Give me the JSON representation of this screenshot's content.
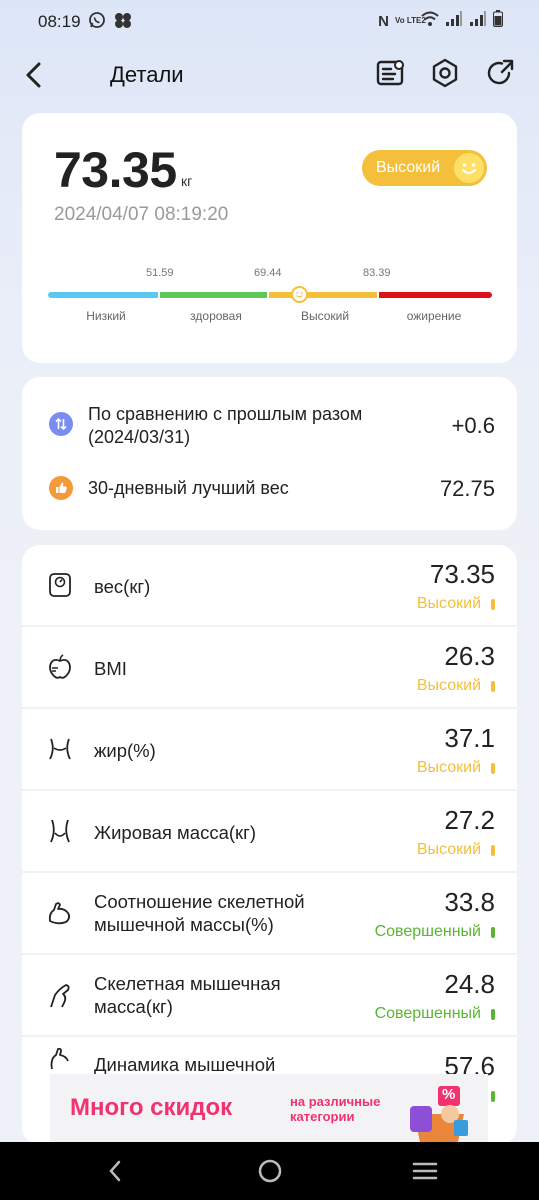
{
  "status_bar": {
    "time": "08:19",
    "left_icons": [
      "whatsapp-icon",
      "app-cluster-icon"
    ],
    "right_icons": [
      "nfc-icon",
      "volte-icon",
      "wifi-icon",
      "signal-icon",
      "signal-icon",
      "battery-icon"
    ],
    "volte_text": "Vo LTE2"
  },
  "header": {
    "title": "Детали",
    "back_icon": "chevron-left-icon",
    "actions": [
      "report-icon",
      "settings-icon",
      "share-icon"
    ]
  },
  "summary": {
    "weight": "73.35",
    "unit": "кг",
    "datetime": "2024/04/07 08:19:20",
    "status": "Высокий",
    "status_color": "#f4bf3a",
    "thresholds": [
      "51.59",
      "69.44",
      "83.39"
    ],
    "ranges": [
      {
        "label": "Низкий",
        "color": "#5ac8f0"
      },
      {
        "label": "здоровая",
        "color": "#5cc85a"
      },
      {
        "label": "Высокий",
        "color": "#f4bf3a"
      },
      {
        "label": "ожирение",
        "color": "#e0101a"
      }
    ]
  },
  "comparison": {
    "previous_label": "По сравнению с прошлым разом",
    "previous_date": "(2024/03/31)",
    "previous_delta": "+0.6",
    "best_label": "30-дневный лучший вес",
    "best_value": "72.75"
  },
  "metrics": [
    {
      "icon": "scale-icon",
      "label": "вес(кг)",
      "value": "73.35",
      "status": "Высокий",
      "color": "#f4bf3a"
    },
    {
      "icon": "apple-icon",
      "label": "BMI",
      "value": "26.3",
      "status": "Высокий",
      "color": "#f4bf3a"
    },
    {
      "icon": "waist-icon",
      "label": "жир(%)",
      "value": "37.1",
      "status": "Высокий",
      "color": "#f4bf3a"
    },
    {
      "icon": "body-shape-icon",
      "label": "Жировая масса(кг)",
      "value": "27.2",
      "status": "Высокий",
      "color": "#f4bf3a"
    },
    {
      "icon": "bicep-icon",
      "label": "Соотношение скелетной мышечной массы(%)",
      "label_line1": "Соотношение скелетной",
      "label_line2": "мышечной массы(%)",
      "value": "33.8",
      "status": "Совершенный",
      "color": "#5ab52f"
    },
    {
      "icon": "muscle-leg-icon",
      "label": "Скелетная мышечная масса(кг)",
      "label_line1": "Скелетная мышечная",
      "label_line2": "масса(кг)",
      "value": "24.8",
      "status": "Совершенный",
      "color": "#5ab52f"
    },
    {
      "icon": "muscle-arm-icon",
      "label": "Динамика мышечной",
      "value": "57.6",
      "status": "",
      "color": "#5ab52f"
    }
  ],
  "ad": {
    "headline": "Много скидок",
    "subline1": "на различные",
    "subline2": "категории",
    "badge": "%",
    "color": "#f0326e"
  },
  "nav": [
    "back-nav-icon",
    "home-nav-icon",
    "recents-nav-icon"
  ]
}
